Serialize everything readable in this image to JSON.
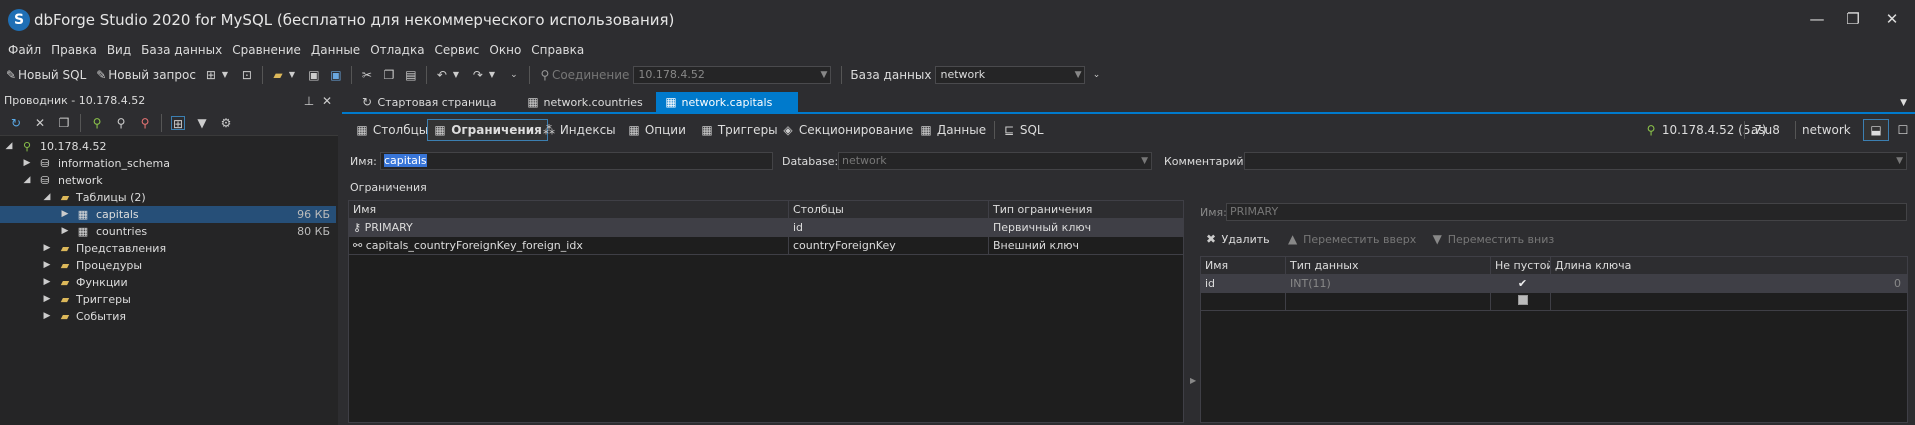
{
  "app": {
    "title": "dbForge Studio 2020 for MySQL (бесплатно для некоммерческого использования)",
    "icon_letter": "S"
  },
  "window_controls": {
    "minimize": "—",
    "restore": "❐",
    "close": "✕"
  },
  "menu": [
    "Файл",
    "Правка",
    "Вид",
    "База данных",
    "Сравнение",
    "Данные",
    "Отладка",
    "Сервис",
    "Окно",
    "Справка"
  ],
  "toolbar": {
    "new_sql": "Новый SQL",
    "new_query": "Новый запрос",
    "connection_label": "Соединение",
    "connection_value": "10.178.4.52",
    "database_label": "База данных",
    "database_value": "network"
  },
  "explorer": {
    "title": "Проводник - 10.178.4.52",
    "tree": [
      {
        "label": "10.178.4.52",
        "icon": "server-icon"
      },
      {
        "label": "information_schema",
        "icon": "database-icon"
      },
      {
        "label": "network",
        "icon": "database-icon"
      },
      {
        "label": "Таблицы (2)",
        "icon": "folder-icon"
      },
      {
        "label": "capitals",
        "icon": "table-icon",
        "size": "96 КБ"
      },
      {
        "label": "countries",
        "icon": "table-icon",
        "size": "80 КБ"
      },
      {
        "label": "Представления",
        "icon": "folder-icon"
      },
      {
        "label": "Процедуры",
        "icon": "folder-icon"
      },
      {
        "label": "Функции",
        "icon": "folder-icon"
      },
      {
        "label": "Триггеры",
        "icon": "folder-icon"
      },
      {
        "label": "События",
        "icon": "folder-icon"
      }
    ]
  },
  "doc_tabs": [
    {
      "label": "Стартовая страница"
    },
    {
      "label": "network.countries"
    },
    {
      "label": "network.capitals",
      "close": "✕"
    }
  ],
  "editor_tabs": [
    "Столбцы",
    "Ограничения",
    "Индексы",
    "Опции",
    "Триггеры",
    "Секционирование",
    "Данные",
    "SQL"
  ],
  "status": {
    "server": "10.178.4.52 (5.7)",
    "user": "asu8",
    "db": "network"
  },
  "form": {
    "name_label": "Имя:",
    "name_value": "capitals",
    "database_label": "Database:",
    "database_value": "network",
    "comment_label": "Комментарий:",
    "section": "Ограничения"
  },
  "constraints": {
    "headers": [
      "Имя",
      "Столбцы",
      "Тип ограничения"
    ],
    "rows": [
      {
        "name": "PRIMARY",
        "columns": "id",
        "type": "Первичный ключ"
      },
      {
        "name": "capitals_countryForeignKey_foreign_idx",
        "columns": "countryForeignKey",
        "type": "Внешний ключ"
      }
    ]
  },
  "detail": {
    "name_label": "Имя:",
    "name_value": "PRIMARY",
    "delete": "Удалить",
    "move_up": "Переместить вверх",
    "move_down": "Переместить вниз",
    "headers": [
      "Имя",
      "Тип данных",
      "Не пустой",
      "Длина ключа"
    ],
    "rows": [
      {
        "name": "id",
        "type": "INT(11)",
        "not_null": true,
        "key_len": "0"
      }
    ]
  }
}
